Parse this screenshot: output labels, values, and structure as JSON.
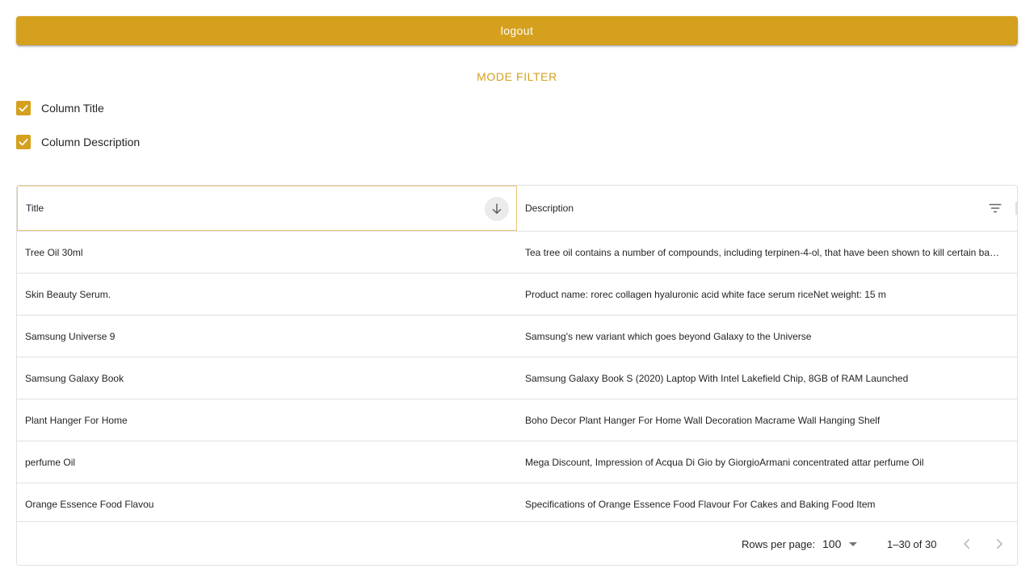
{
  "header": {
    "logout_label": "logout"
  },
  "filter": {
    "mode_label": "MODE FILTER",
    "options": [
      {
        "label": "Column Title",
        "checked": true
      },
      {
        "label": "Column Description",
        "checked": true
      }
    ]
  },
  "table": {
    "columns": [
      "Title",
      "Description"
    ],
    "sort": {
      "column": "Title",
      "direction": "descending"
    },
    "rows": [
      {
        "title": "Tree Oil 30ml",
        "description": "Tea tree oil contains a number of compounds, including terpinen-4-ol, that have been shown to kill certain ba…"
      },
      {
        "title": "Skin Beauty Serum.",
        "description": "Product name: rorec collagen hyaluronic acid white face serum riceNet weight: 15 m"
      },
      {
        "title": "Samsung Universe 9",
        "description": "Samsung's new variant which goes beyond Galaxy to the Universe"
      },
      {
        "title": "Samsung Galaxy Book",
        "description": "Samsung Galaxy Book S (2020) Laptop With Intel Lakefield Chip, 8GB of RAM Launched"
      },
      {
        "title": "Plant Hanger For Home",
        "description": "Boho Decor Plant Hanger For Home Wall Decoration Macrame Wall Hanging Shelf"
      },
      {
        "title": "perfume Oil",
        "description": "Mega Discount, Impression of Acqua Di Gio by GiorgioArmani concentrated attar perfume Oil"
      },
      {
        "title": "Orange Essence Food Flavou",
        "description": "Specifications of Orange Essence Food Flavour For Cakes and Baking Food Item"
      }
    ]
  },
  "pagination": {
    "rows_per_page_label": "Rows per page:",
    "rows_per_page_value": "100",
    "range_label": "1–30 of 30"
  },
  "icons": {
    "sort": "arrow-down-icon",
    "filter": "filter-list-icon",
    "check": "check-icon",
    "dropdown": "dropdown-arrow-icon",
    "prev": "chevron-left-icon",
    "next": "chevron-right-icon"
  },
  "colors": {
    "accent": "#d4a01d",
    "border": "#e0e0e0"
  }
}
